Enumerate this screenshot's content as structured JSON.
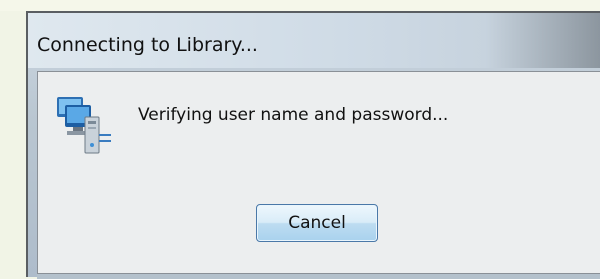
{
  "dialog": {
    "title": "Connecting to Library...",
    "message": "Verifying user name and password...",
    "icon": "network-computer-icon",
    "cancel_label": "Cancel"
  }
}
